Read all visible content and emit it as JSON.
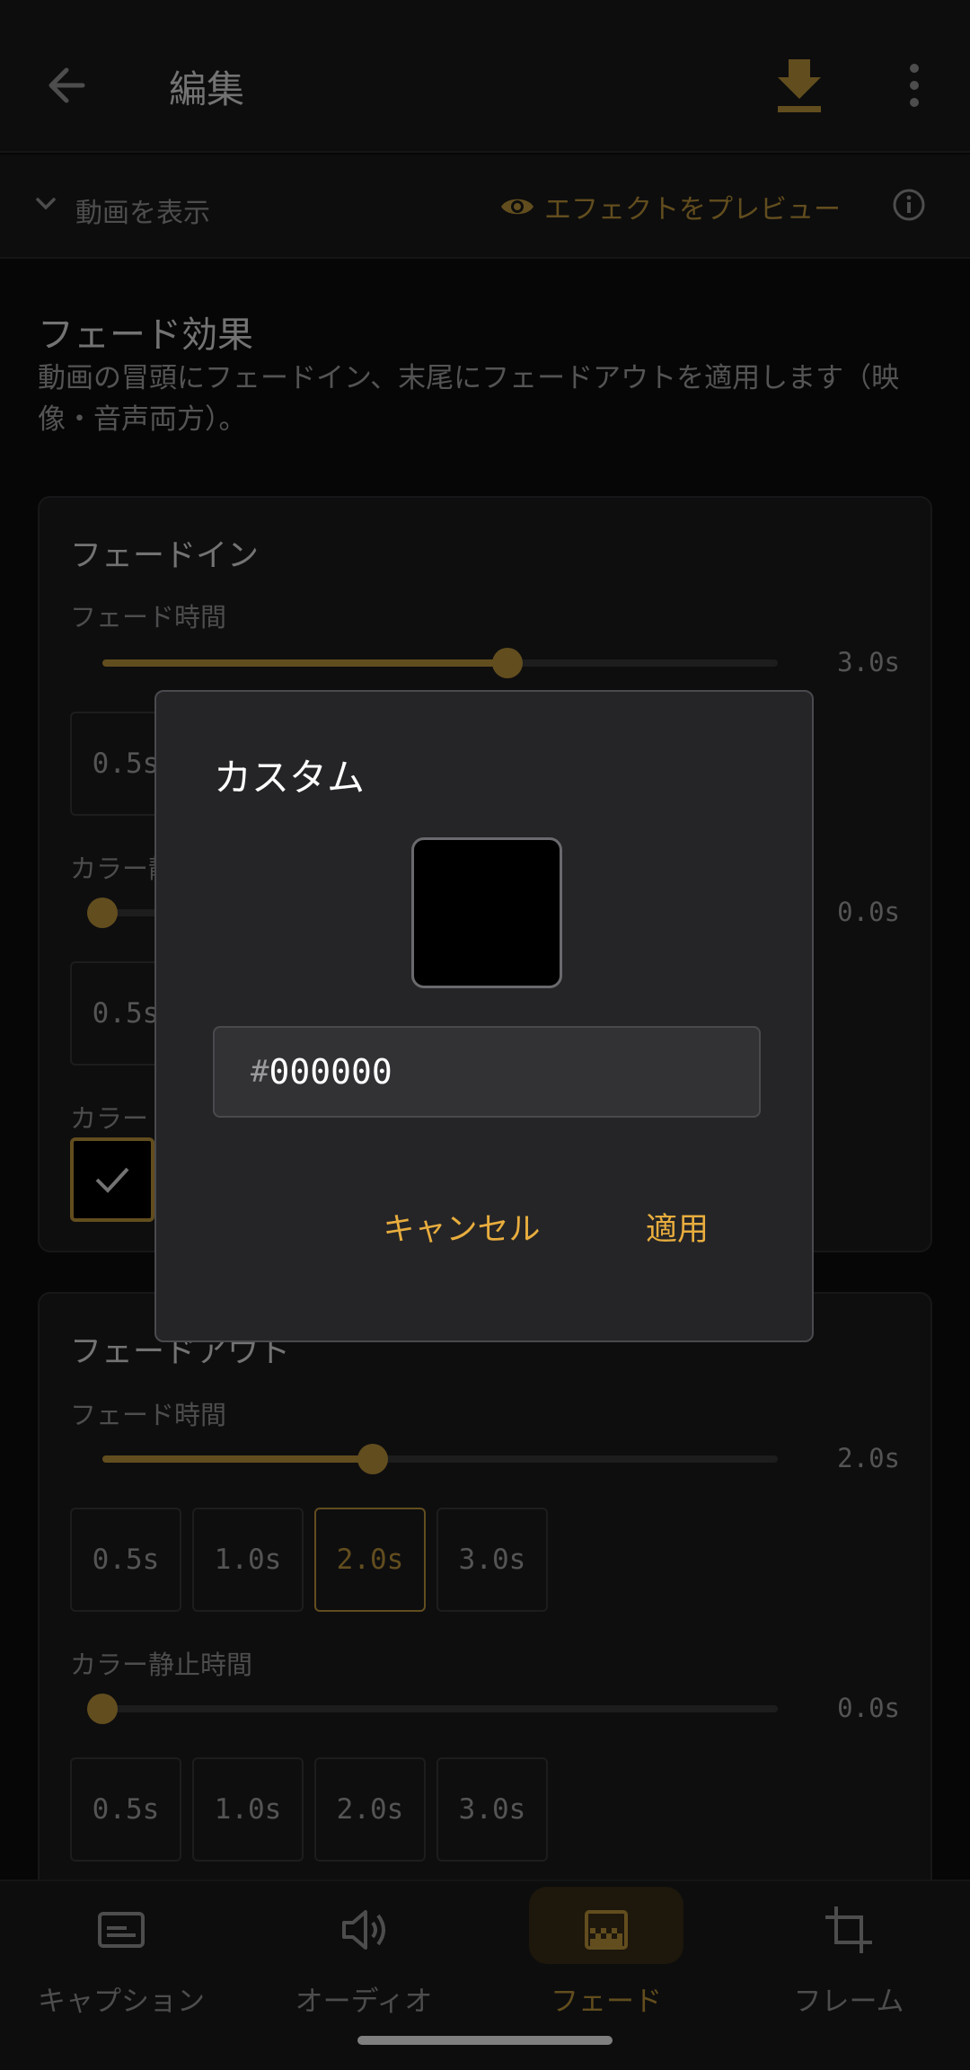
{
  "header": {
    "title": "編集"
  },
  "subbar": {
    "show_video": "動画を表示",
    "preview_effect": "エフェクトをプレビュー"
  },
  "section": {
    "title": "フェード効果",
    "description": "動画の冒頭にフェードイン、末尾にフェードアウトを適用します（映像・音声両方）。"
  },
  "fade_in": {
    "title": "フェードイン",
    "duration_label": "フェード時間",
    "duration_value": "3.0s",
    "duration_fraction": 0.6,
    "chip_first": "0.5s",
    "hold_label": "カラー静",
    "hold_value": "0.0s",
    "hold_chip_first": "0.5s",
    "color_label": "カラー"
  },
  "fade_out": {
    "title": "フェードアウト",
    "duration_label": "フェード時間",
    "duration_value": "2.0s",
    "duration_fraction": 0.4,
    "chips": [
      "0.5s",
      "1.0s",
      "2.0s",
      "3.0s"
    ],
    "selected_chip": "2.0s",
    "hold_label": "カラー静止時間",
    "hold_value": "0.0s",
    "hold_chips": [
      "0.5s",
      "1.0s",
      "2.0s",
      "3.0s"
    ]
  },
  "bottom_nav": [
    {
      "label": "キャプション",
      "icon": "caption-icon"
    },
    {
      "label": "オーディオ",
      "icon": "volume-icon"
    },
    {
      "label": "フェード",
      "icon": "fade-icon",
      "active": true
    },
    {
      "label": "フレーム",
      "icon": "crop-icon"
    }
  ],
  "dialog": {
    "title": "カスタム",
    "preview_color": "#000000",
    "hash": "#",
    "hex_value": "000000",
    "cancel": "キャンセル",
    "apply": "適用"
  },
  "colors": {
    "accent": "#c49a3c",
    "dialog_button": "#e8ad3e",
    "background": "#0d0d0e"
  }
}
